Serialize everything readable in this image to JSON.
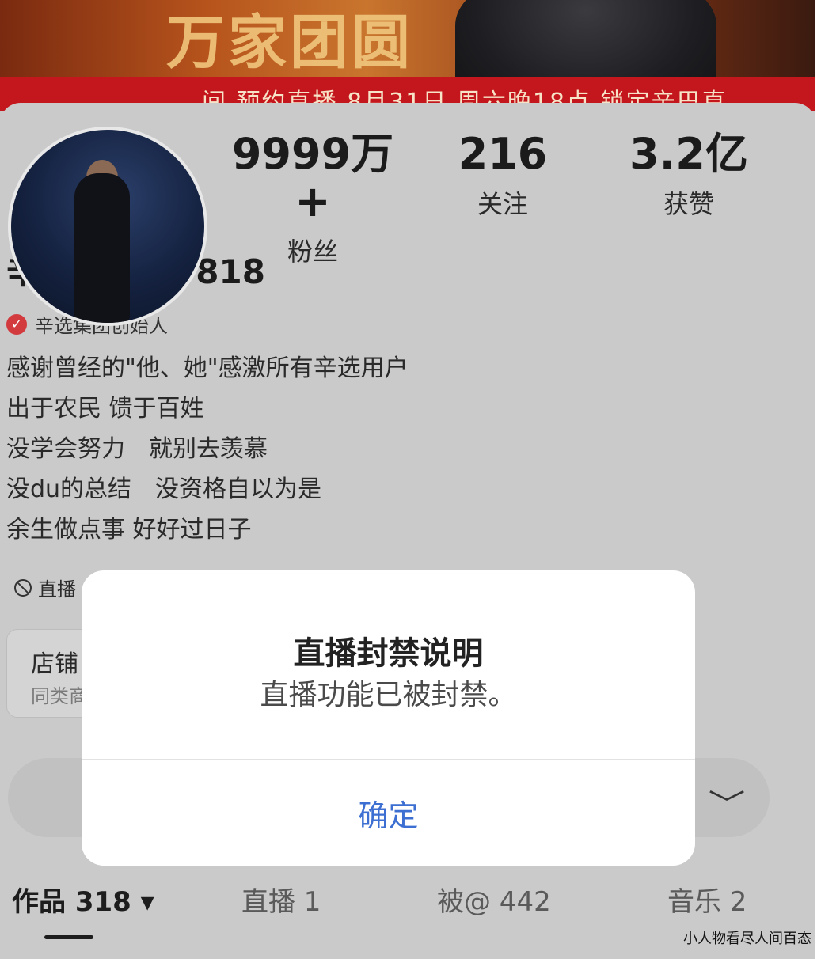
{
  "banner": {
    "slogan": "万家团圆",
    "strip_text": "间 预约直播   8月31日 周六晚18点 锁定辛巴直"
  },
  "stats": [
    {
      "value": "9999万+",
      "label": "粉丝"
    },
    {
      "value": "216",
      "label": "关注"
    },
    {
      "value": "3.2亿",
      "label": "获赞"
    }
  ],
  "profile": {
    "name": "辛有志 辛巴 818",
    "verify_icon_text": "✓",
    "verify_text": "辛选集团创始人",
    "bio": [
      "感谢曾经的\"他、她\"感激所有辛选用户",
      "出于农民 馈于百姓",
      "没学会努力　就别去羡慕",
      "没du的总结　没资格自以为是",
      "余生做点事 好好过日子"
    ],
    "live_ban_text": "直播"
  },
  "shop_card": {
    "title": "店铺",
    "subtitle": "同类商"
  },
  "search": {
    "chevron": "﹀"
  },
  "tabs": [
    {
      "label": "作品 318 ▾"
    },
    {
      "label": "直播 1"
    },
    {
      "label": "被@ 442"
    },
    {
      "label": "音乐 2"
    }
  ],
  "modal": {
    "title": "直播封禁说明",
    "message": "直播功能已被封禁。",
    "confirm": "确定"
  },
  "watermark": "小人物看尽人间百态"
}
